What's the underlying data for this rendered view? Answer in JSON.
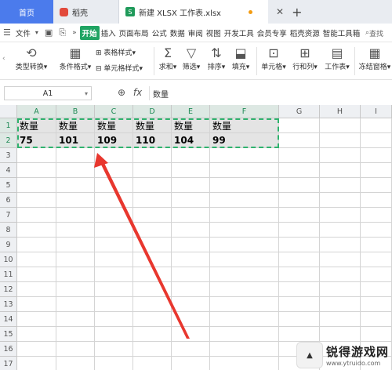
{
  "tabs": {
    "home": "首页",
    "docer": "稻壳",
    "file": "新建 XLSX 工作表.xlsx",
    "add": "+"
  },
  "menu": {
    "file": "文件",
    "items": [
      "开始",
      "插入",
      "页面布局",
      "公式",
      "数据",
      "审阅",
      "视图",
      "开发工具",
      "会员专享",
      "稻壳资源",
      "智能工具箱"
    ],
    "search": "查找"
  },
  "ribbon": {
    "type_convert": "类型转换",
    "cond_format": "条件格式",
    "table_style": "表格样式",
    "cell_style": "单元格样式",
    "sum": "求和",
    "filter": "筛选",
    "sort": "排序",
    "fill": "填充",
    "cell": "单元格",
    "rowcol": "行和列",
    "sheet": "工作表",
    "freeze": "冻结窗格"
  },
  "formula_bar": {
    "name_box": "A1",
    "fx": "fx",
    "value": "数量"
  },
  "sheet": {
    "columns": [
      "A",
      "B",
      "C",
      "D",
      "E",
      "F",
      "G",
      "H",
      "I"
    ],
    "rows": [
      "1",
      "2",
      "3",
      "4",
      "5",
      "6",
      "7",
      "8",
      "9",
      "10",
      "11",
      "12",
      "13",
      "14",
      "15",
      "16",
      "17"
    ],
    "row1": [
      "数量",
      "数量",
      "数量",
      "数量",
      "数量",
      "数量"
    ],
    "row2": [
      "75",
      "101",
      "109",
      "110",
      "104",
      "99"
    ]
  },
  "watermark": {
    "title": "锐得游戏网",
    "url": "www.ytruido.com"
  },
  "colors": {
    "accent_green": "#20a463",
    "selection_border": "#2fb36e",
    "arrow": "#e8372e",
    "home_tab": "#4b7bec"
  }
}
